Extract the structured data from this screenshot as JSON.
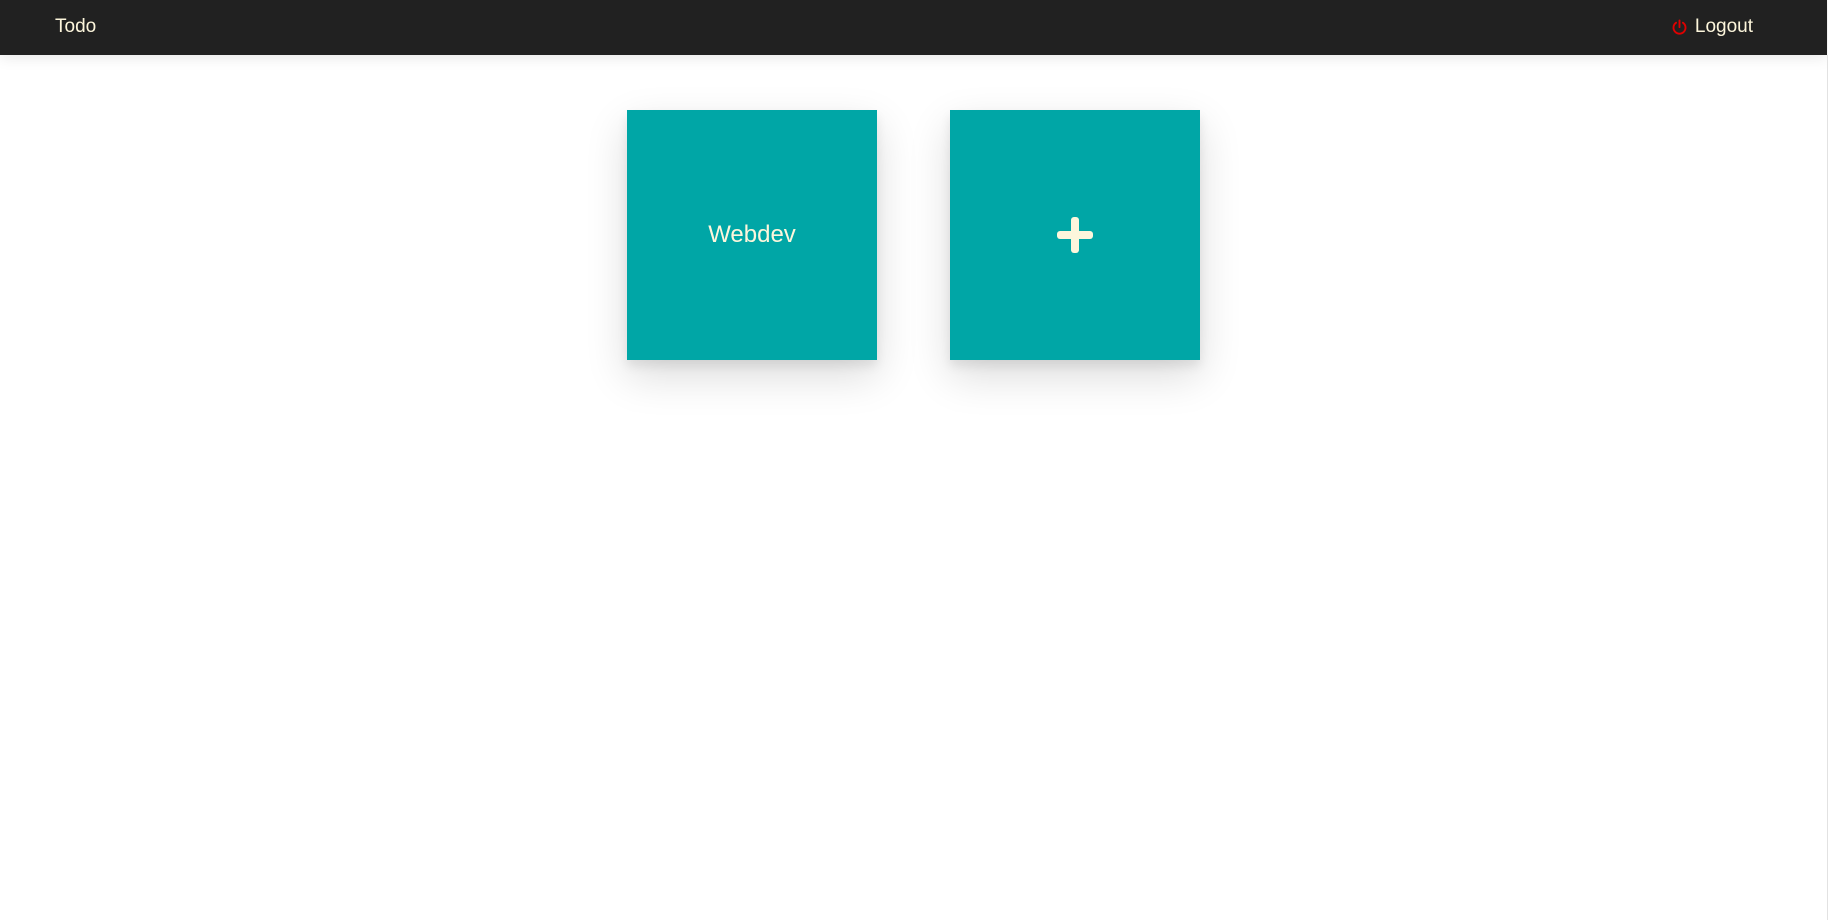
{
  "navbar": {
    "brand": "Todo",
    "logout_label": "Logout",
    "logout_icon": "power-icon"
  },
  "boards": [
    {
      "title": "Webdev"
    }
  ],
  "add_board": {
    "icon": "plus-icon"
  },
  "colors": {
    "navbar_bg": "#212121",
    "card_bg": "#00a6a6",
    "text_light": "#fdf6dc",
    "logout_icon": "#e00000"
  }
}
